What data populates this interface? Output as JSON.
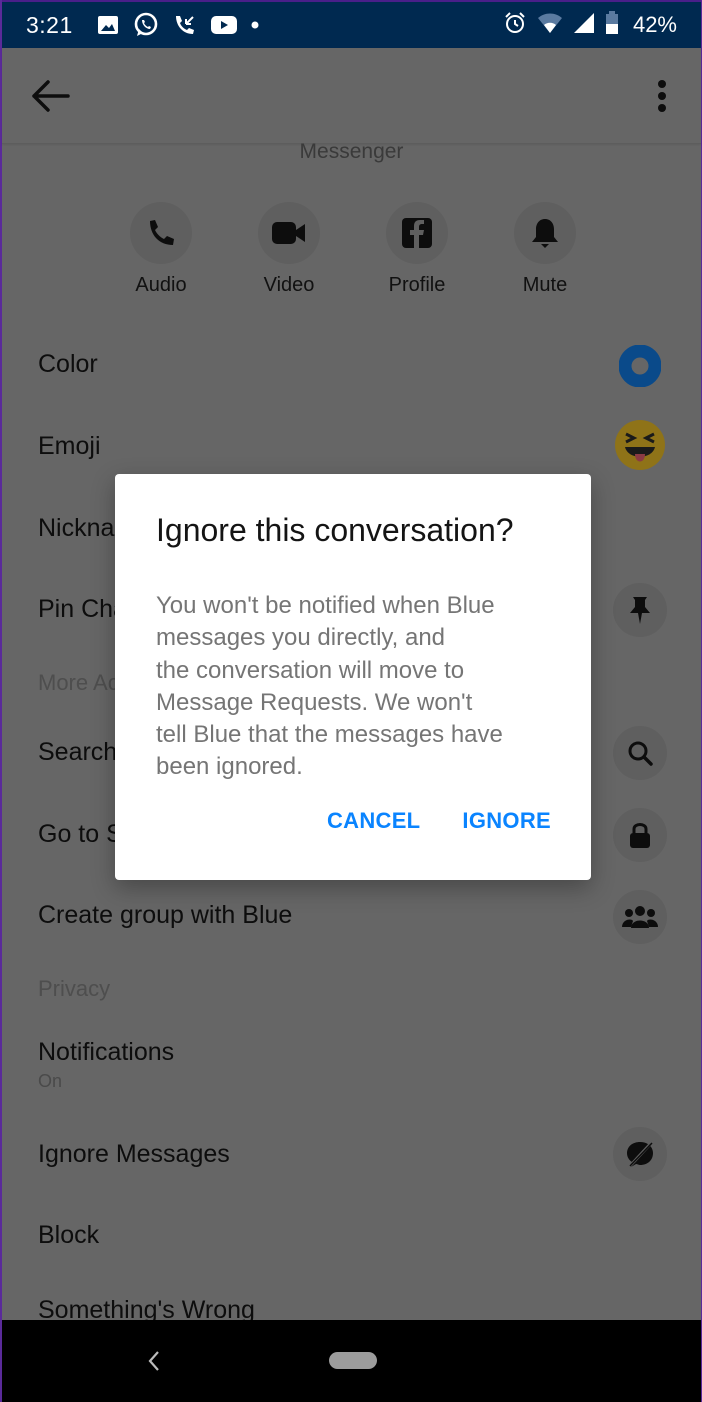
{
  "status_bar": {
    "time": "3:21",
    "left_icons": [
      "image-icon",
      "whatsapp-icon",
      "missed-call-icon",
      "youtube-icon",
      "dot-icon"
    ],
    "right_icons": [
      "alarm-icon",
      "wifi-icon",
      "signal-icon",
      "battery-icon"
    ],
    "battery": "42%"
  },
  "app_bar": {
    "back_icon": "arrow-left-icon",
    "menu_icon": "more-vertical-icon"
  },
  "subtitle": "Messenger",
  "quick_actions": [
    {
      "label": "Audio",
      "icon": "phone-icon"
    },
    {
      "label": "Video",
      "icon": "video-camera-icon"
    },
    {
      "label": "Profile",
      "icon": "facebook-icon"
    },
    {
      "label": "Mute",
      "icon": "bell-icon"
    }
  ],
  "settings": {
    "color": {
      "label": "Color",
      "accent": "#0a4a8a"
    },
    "emoji": {
      "label": "Emoji",
      "icon": "squinting-tongue-emoji-icon"
    },
    "nickname": {
      "label": "Nicknames"
    },
    "pin": {
      "label": "Pin Chat",
      "icon": "pin-icon"
    },
    "more_actions_header": "More Actions",
    "search": {
      "label": "Search in Conversation",
      "icon": "search-icon"
    },
    "secret": {
      "label": "Go to Secret Conversation",
      "icon": "lock-icon"
    },
    "create_group": {
      "label": "Create group with Blue",
      "icon": "group-icon"
    },
    "privacy_header": "Privacy",
    "notifications": {
      "label": "Notifications",
      "value": "On"
    },
    "ignore": {
      "label": "Ignore Messages",
      "icon": "ignore-bubble-icon"
    },
    "block": {
      "label": "Block"
    },
    "wrong": {
      "label": "Something's Wrong"
    }
  },
  "dialog": {
    "title": "Ignore this conversation?",
    "body_lines": [
      "You won't be notified when Blue",
      "messages you directly, and",
      "the conversation will move to",
      "Message Requests. We won't",
      "tell Blue that the messages have",
      "been ignored."
    ],
    "cancel_label": "CANCEL",
    "confirm_label": "IGNORE",
    "button_color": "#0a84ff"
  },
  "nav_bar": {
    "back_icon": "nav-back-icon",
    "home_icon": "nav-home-pill-icon"
  }
}
